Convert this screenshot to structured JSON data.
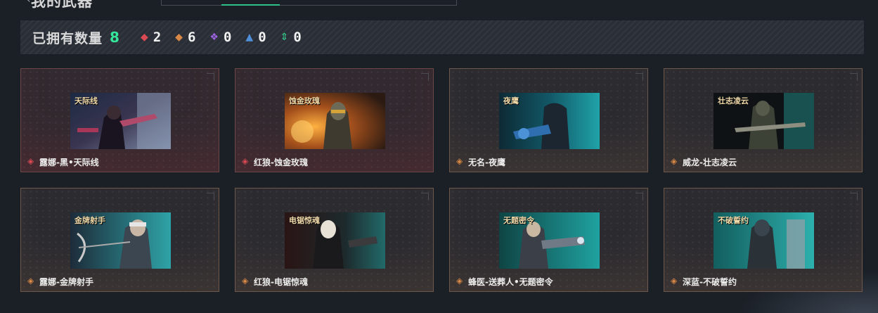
{
  "header": {
    "title": "我的武器"
  },
  "summary": {
    "label": "已拥有数量",
    "total": "8",
    "rarities": [
      {
        "icon": "red-diamond-icon",
        "color": "#d94a52",
        "count": "2"
      },
      {
        "icon": "orange-diamond-icon",
        "color": "#d98845",
        "count": "6"
      },
      {
        "icon": "purple-diamond-icon",
        "color": "#9b63e0",
        "count": "0"
      },
      {
        "icon": "blue-triangle-icon",
        "color": "#4f8fd9",
        "count": "0"
      },
      {
        "icon": "green-arrow-icon",
        "color": "#34c98a",
        "count": "0"
      }
    ]
  },
  "cards": [
    {
      "name": "露娜-黑•天际线",
      "rarity": "red",
      "thumb_title": "天际线"
    },
    {
      "name": "红狼-蚀金玫瑰",
      "rarity": "red",
      "thumb_title": "蚀金玫瑰"
    },
    {
      "name": "无名-夜鹰",
      "rarity": "orange",
      "thumb_title": "夜鹰"
    },
    {
      "name": "威龙-壮志凌云",
      "rarity": "orange",
      "thumb_title": "壮志凌云"
    },
    {
      "name": "露娜-金牌射手",
      "rarity": "orange",
      "thumb_title": "金牌射手"
    },
    {
      "name": "红狼-电锯惊魂",
      "rarity": "orange",
      "thumb_title": "电锯惊魂"
    },
    {
      "name": "蜂医-送葬人•无题密令",
      "rarity": "orange",
      "thumb_title": "无题密令"
    },
    {
      "name": "深蓝-不破誓约",
      "rarity": "orange",
      "thumb_title": "不破誓约"
    }
  ],
  "rarity_colors": {
    "red": "#d94a52",
    "orange": "#d98845"
  }
}
